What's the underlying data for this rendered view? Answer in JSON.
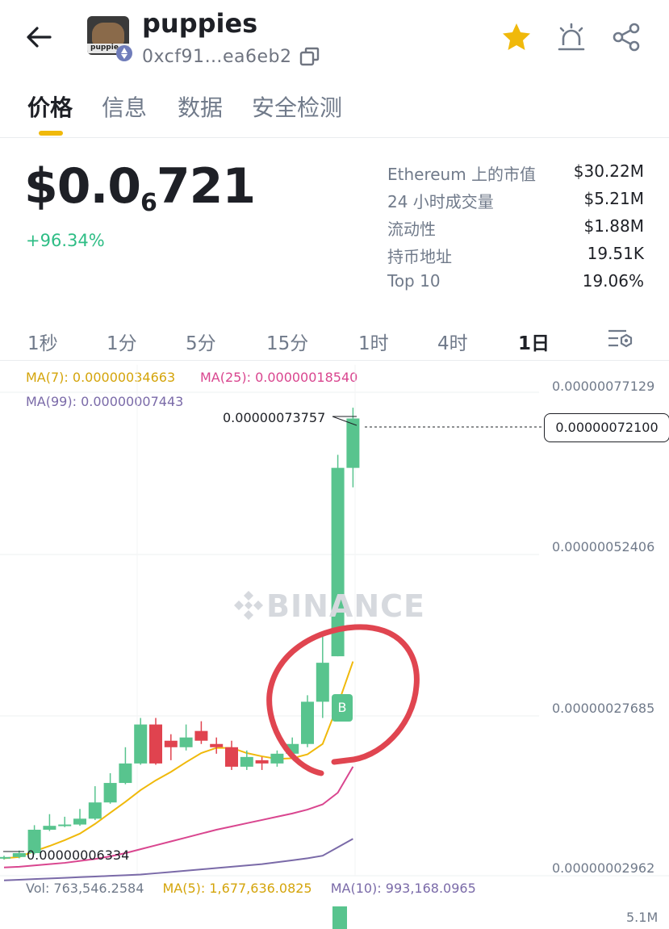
{
  "header": {
    "token_name": "puppies",
    "avatar_text": "puppie",
    "address": "0xcf91…ea6eb2",
    "icons": {
      "back": "back-arrow-icon",
      "copy": "copy-icon",
      "favorite": "star-icon",
      "alert": "alarm-icon",
      "share": "share-icon",
      "network": "ethereum-icon"
    },
    "star_color": "#f0b90b"
  },
  "tabs": [
    {
      "label": "价格",
      "active": true
    },
    {
      "label": "信息",
      "active": false
    },
    {
      "label": "数据",
      "active": false
    },
    {
      "label": "安全检测",
      "active": false
    }
  ],
  "price": {
    "main": "$0.0",
    "subscript": "6",
    "rest": "721",
    "change": "+96.34%",
    "change_color": "#2ebd85"
  },
  "stats": [
    {
      "label": "Ethereum 上的市值",
      "value": "$30.22M"
    },
    {
      "label": "24 小时成交量",
      "value": "$5.21M"
    },
    {
      "label": "流动性",
      "value": "$1.88M"
    },
    {
      "label": "持币地址",
      "value": "19.51K"
    },
    {
      "label": "Top 10",
      "value": "19.06%"
    }
  ],
  "timeframes": [
    {
      "label": "1秒",
      "active": false
    },
    {
      "label": "1分",
      "active": false
    },
    {
      "label": "5分",
      "active": false
    },
    {
      "label": "15分",
      "active": false
    },
    {
      "label": "1时",
      "active": false
    },
    {
      "label": "4时",
      "active": false
    },
    {
      "label": "1日",
      "active": true
    }
  ],
  "chart": {
    "ma7": "MA(7): 0.00000034663",
    "ma25": "MA(25): 0.00000018540",
    "ma99": "MA(99): 0.00000007443",
    "high_label": "0.00000073757",
    "low_label": "0.00000006334",
    "current_price": "0.00000072100",
    "axis_labels": [
      "0.00000077129",
      "0.00000052406",
      "0.00000027685",
      "0.00000002962"
    ],
    "watermark": "BINANCE",
    "buy_marker": "B",
    "volume": "Vol: 763,546.2584",
    "vol_ma5": "MA(5): 1,677,636.0825",
    "vol_ma10": "MA(10): 993,168.0965",
    "vol_axis": "5.1M",
    "colors": {
      "up": "#58c48e",
      "down": "#e0434f",
      "ma7": "#f0b90b",
      "ma25": "#d9468f",
      "ma99": "#7a6aa8",
      "annotation": "#e04550"
    },
    "candles": [
      {
        "open": 4.4e-08,
        "close": 4.6e-08,
        "high": 4.8e-08,
        "low": 4.2e-08
      },
      {
        "open": 4.6e-08,
        "close": 5.2e-08,
        "high": 5.6e-08,
        "low": 4.4e-08
      },
      {
        "open": 5.2e-08,
        "close": 8.8e-08,
        "high": 9.5e-08,
        "low": 5e-08
      },
      {
        "open": 8.8e-08,
        "close": 9.4e-08,
        "high": 1.12e-07,
        "low": 8.6e-08
      },
      {
        "open": 9.4e-08,
        "close": 9.6e-08,
        "high": 1.08e-07,
        "low": 9.2e-08
      },
      {
        "open": 9.6e-08,
        "close": 1.05e-07,
        "high": 1.2e-07,
        "low": 9.4e-08
      },
      {
        "open": 1.05e-07,
        "close": 1.3e-07,
        "high": 1.55e-07,
        "low": 1.03e-07
      },
      {
        "open": 1.3e-07,
        "close": 1.6e-07,
        "high": 1.75e-07,
        "low": 1.28e-07
      },
      {
        "open": 1.6e-07,
        "close": 1.9e-07,
        "high": 2.15e-07,
        "low": 1.58e-07
      },
      {
        "open": 1.9e-07,
        "close": 2.5e-07,
        "high": 2.6e-07,
        "low": 1.88e-07
      },
      {
        "open": 2.5e-07,
        "close": 1.9e-07,
        "high": 2.6e-07,
        "low": 1.88e-07
      },
      {
        "open": 2.25e-07,
        "close": 2.15e-07,
        "high": 2.35e-07,
        "low": 1.95e-07
      },
      {
        "open": 2.15e-07,
        "close": 2.3e-07,
        "high": 2.5e-07,
        "low": 2.1e-07
      },
      {
        "open": 2.4e-07,
        "close": 2.25e-07,
        "high": 2.55e-07,
        "low": 2.2e-07
      },
      {
        "open": 2.2e-07,
        "close": 2.15e-07,
        "high": 2.3e-07,
        "low": 2.05e-07
      },
      {
        "open": 2.15e-07,
        "close": 1.85e-07,
        "high": 2.25e-07,
        "low": 1.8e-07
      },
      {
        "open": 1.85e-07,
        "close": 2e-07,
        "high": 2.1e-07,
        "low": 1.8e-07
      },
      {
        "open": 1.95e-07,
        "close": 1.9e-07,
        "high": 2e-07,
        "low": 1.8e-07
      },
      {
        "open": 1.9e-07,
        "close": 2.05e-07,
        "high": 2.1e-07,
        "low": 1.85e-07
      },
      {
        "open": 2.05e-07,
        "close": 2.2e-07,
        "high": 2.3e-07,
        "low": 2e-07
      },
      {
        "open": 2.2e-07,
        "close": 2.85e-07,
        "high": 2.95e-07,
        "low": 2.15e-07
      },
      {
        "open": 2.85e-07,
        "close": 3.45e-07,
        "high": 3.85e-07,
        "low": 2.6e-07
      },
      {
        "open": 3.55e-07,
        "close": 6.45e-07,
        "high": 6.65e-07,
        "low": 3.55e-07
      },
      {
        "open": 6.45e-07,
        "close": 7.21e-07,
        "high": 7.376e-07,
        "low": 6.15e-07
      }
    ],
    "ma7_values": [
      4.4e-08,
      4.6e-08,
      5.5e-08,
      6.3e-08,
      7.2e-08,
      8.2e-08,
      9.7e-08,
      1.14e-07,
      1.31e-07,
      1.49e-07,
      1.64e-07,
      1.77e-07,
      1.92e-07,
      2.06e-07,
      2.14e-07,
      2.14e-07,
      2.06e-07,
      2.01e-07,
      1.97e-07,
      1.98e-07,
      2.04e-07,
      2.2e-07,
      2.8e-07,
      3.47e-07
    ],
    "ma25_values": [
      3e-08,
      3.1e-08,
      3.3e-08,
      3.5e-08,
      3.7e-08,
      4e-08,
      4.3e-08,
      4.7e-08,
      5.2e-08,
      5.8e-08,
      6.4e-08,
      7e-08,
      7.6e-08,
      8.2e-08,
      8.8e-08,
      9.3e-08,
      9.8e-08,
      1.03e-07,
      1.08e-07,
      1.13e-07,
      1.19e-07,
      1.27e-07,
      1.45e-07,
      1.85e-07
    ],
    "ma99_values": [
      1e-08,
      1.1e-08,
      1.2e-08,
      1.3e-08,
      1.4e-08,
      1.5e-08,
      1.6e-08,
      1.7e-08,
      1.8e-08,
      1.9e-08,
      2.1e-08,
      2.3e-08,
      2.5e-08,
      2.7e-08,
      2.9e-08,
      3.1e-08,
      3.3e-08,
      3.5e-08,
      3.8e-08,
      4.1e-08,
      4.4e-08,
      4.8e-08,
      6.1e-08,
      7.4e-08
    ]
  }
}
